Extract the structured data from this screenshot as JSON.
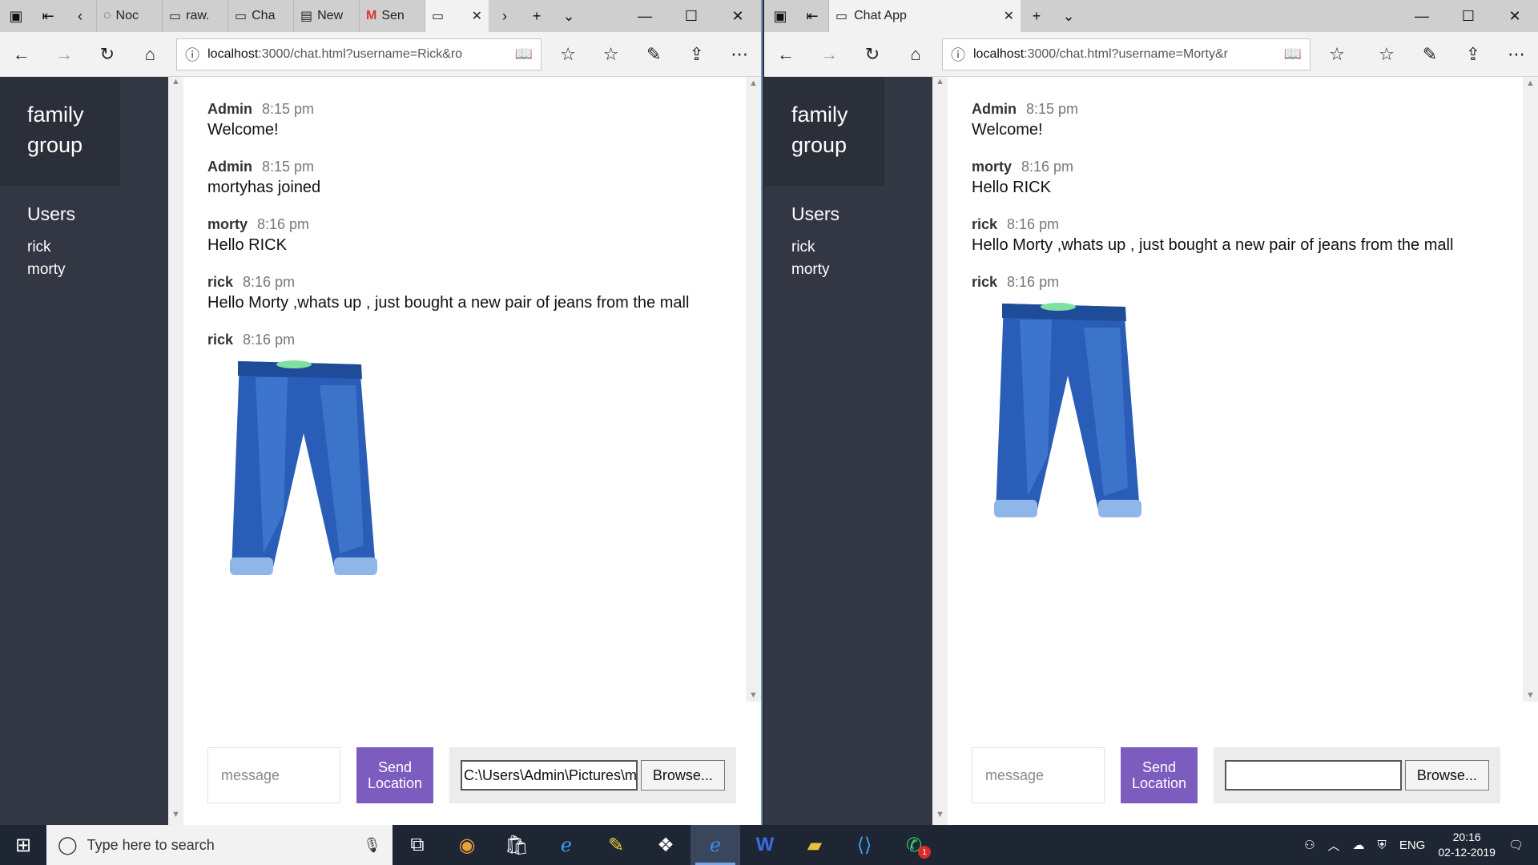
{
  "left_window": {
    "tabs": [
      {
        "label": "Noc",
        "icon": "page-icon"
      },
      {
        "label": "raw.",
        "icon": "tab-icon"
      },
      {
        "label": "Cha",
        "icon": "tab-icon"
      },
      {
        "label": "New",
        "icon": "newtab-icon"
      },
      {
        "label": "Sen",
        "icon": "gmail-icon"
      },
      {
        "label": "",
        "icon": "tab-icon",
        "active": true
      }
    ],
    "address": "localhost:3000/chat.html?username=Rick&ro",
    "address_host": "localhost",
    "address_rest": ":3000/chat.html?username=Rick&ro",
    "sidebar": {
      "title": "family group",
      "users_heading": "Users",
      "users": [
        "rick",
        "morty"
      ]
    },
    "messages": [
      {
        "name": "Admin",
        "time": "8:15 pm",
        "text": "Welcome!"
      },
      {
        "name": "Admin",
        "time": "8:15 pm",
        "text": "mortyhas joined"
      },
      {
        "name": "morty",
        "time": "8:16 pm",
        "text": "Hello RICK"
      },
      {
        "name": "rick",
        "time": "8:16 pm",
        "text": "Hello Morty ,whats up , just bought a new pair of jeans from the mall"
      },
      {
        "name": "rick",
        "time": "8:16 pm",
        "image": "jeans-image"
      }
    ],
    "composer": {
      "placeholder": "message",
      "send_location": "Send Location",
      "file_value": "C:\\Users\\Admin\\Pictures\\m",
      "browse": "Browse..."
    }
  },
  "right_window": {
    "tab_title": "Chat App",
    "address": "localhost:3000/chat.html?username=Morty&r",
    "address_host": "localhost",
    "address_rest": ":3000/chat.html?username=Morty&r",
    "sidebar": {
      "title": "family group",
      "users_heading": "Users",
      "users": [
        "rick",
        "morty"
      ]
    },
    "messages": [
      {
        "name": "Admin",
        "time": "8:15 pm",
        "text": "Welcome!"
      },
      {
        "name": "morty",
        "time": "8:16 pm",
        "text": "Hello RICK"
      },
      {
        "name": "rick",
        "time": "8:16 pm",
        "text": "Hello Morty ,whats up , just bought a new pair of jeans from the mall"
      },
      {
        "name": "rick",
        "time": "8:16 pm",
        "image": "jeans-image"
      }
    ],
    "composer": {
      "placeholder": "message",
      "send_location": "Send Location",
      "file_value": "",
      "browse": "Browse..."
    }
  },
  "taskbar": {
    "search_placeholder": "Type here to search",
    "apps": [
      "task-view-icon",
      "chrome-icon",
      "store-icon",
      "ie-icon",
      "sticky-icon",
      "dropbox-icon",
      "edge-icon",
      "word-icon",
      "explorer-icon",
      "vscode-icon",
      "whatsapp-icon"
    ],
    "whatsapp_badge": "1",
    "language": "ENG",
    "time": "20:16",
    "date": "02-12-2019"
  },
  "colors": {
    "sidebar": "#333744",
    "sidebar_header": "#2b2f3a",
    "send_button": "#7c5cbf",
    "taskbar": "#1f2633"
  }
}
